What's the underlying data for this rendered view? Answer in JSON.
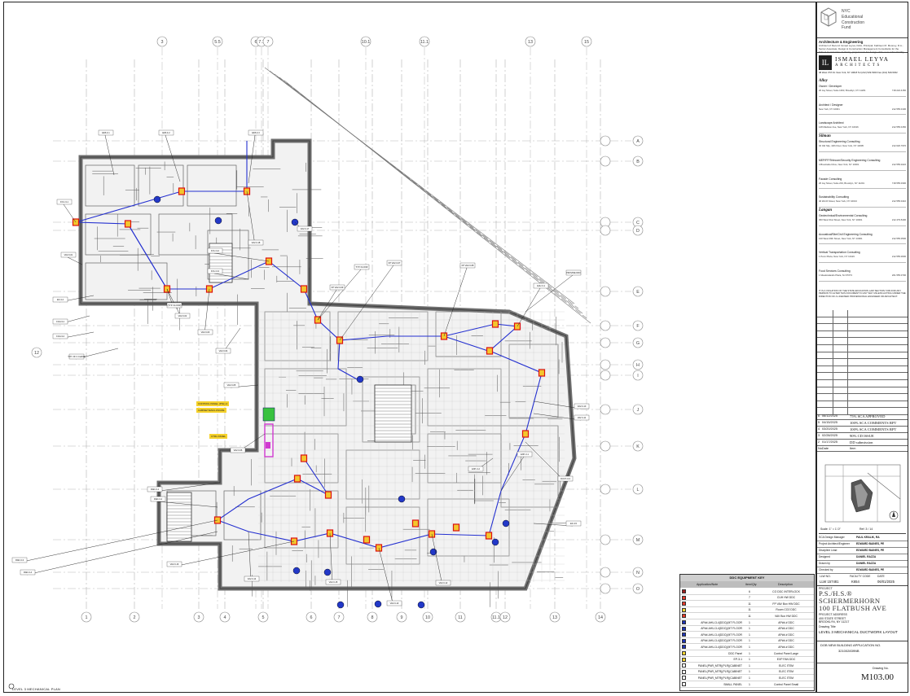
{
  "plan": {
    "title": "LEVEL 3 MECHANICAL PLAN",
    "grid_top": [
      "3",
      "5.5",
      "6",
      "7.1",
      "7",
      "10.1",
      "11.1",
      "13",
      "15"
    ],
    "grid_bottom": [
      "1",
      "2",
      "3",
      "4",
      "5",
      "6",
      "7",
      "8",
      "9",
      "10",
      "11",
      "11.1",
      "12",
      "13",
      "14"
    ],
    "grid_right": [
      "A",
      "B",
      "C",
      "D",
      "E",
      "F",
      "G",
      "H",
      "I",
      "J",
      "K",
      "L",
      "M",
      "N",
      "O"
    ],
    "grid_left": [
      "12"
    ]
  },
  "legend": {
    "title": "DDC EQUIPMENT KEY",
    "headers": {
      "application": "Application/Note",
      "qty": "Item/Qty",
      "description": "Description"
    },
    "rows": [
      {
        "application": "",
        "qty": "6",
        "description": "CO DDC INTERLOCK",
        "color": "#9b1e1e"
      },
      {
        "application": "",
        "qty": "7",
        "description": "CUH HW DDC",
        "color": "#e53a2a"
      },
      {
        "application": "",
        "qty": "11",
        "description": "FP VAV Box HW DDC",
        "color": "#e53a2a"
      },
      {
        "application": "",
        "qty": "11",
        "description": "Room CO2 DDC",
        "color": "#f3d32e"
      },
      {
        "application": "",
        "qty": "11",
        "description": "VAV Box HW DDC",
        "color": "#e53a2a"
      },
      {
        "application": "AP##-AHU-3-4(DDC)(MT FLOOR",
        "qty": "1",
        "description": "AP##-# DDC",
        "color": "#1f35b5"
      },
      {
        "application": "AP##-AHU-3-4(DDC)(MT FLOOR",
        "qty": "1",
        "description": "AP##-# DDC",
        "color": "#1f35b5"
      },
      {
        "application": "AP##-AHU-3-4(DDC)(MT FLOOR",
        "qty": "1",
        "description": "AP##-# DDC",
        "color": "#1f35b5"
      },
      {
        "application": "AP##-AHU-3-4(DDC)(MT FLOOR",
        "qty": "1",
        "description": "AP##-# DDC",
        "color": "#1f35b5"
      },
      {
        "application": "AP##-AHU-3-4(DDC)(MT FLOOR",
        "qty": "1",
        "description": "AP##-# DDC",
        "color": "#1f35b5"
      },
      {
        "application": "DDC Panel",
        "qty": "1",
        "description": "Control Panel Large",
        "color": "#f3d32e"
      },
      {
        "application": "EP-3-1",
        "qty": "1",
        "description": "EXP FAN DDC",
        "color": "#f3d32e"
      },
      {
        "application": "PANEL(PNR_MTR)(PLR)(CABINET",
        "qty": "1",
        "description": "ELEC ITEM",
        "color": "#ffffff"
      },
      {
        "application": "PANEL(PNR_MTR)(PLR)(CABINET",
        "qty": "1",
        "description": "ELEC ITEM",
        "color": "#ffffff"
      },
      {
        "application": "PANEL(PNR_MTR)(PLR)(CABINET",
        "qty": "1",
        "description": "ELEC ITEM",
        "color": "#ffffff"
      },
      {
        "application": "SMALL PANEL",
        "qty": "1",
        "description": "Control Panel Small",
        "color": "#ffffff"
      }
    ]
  },
  "titleblock": {
    "org": [
      "NYC",
      "Educational",
      "Construction",
      "Fund"
    ],
    "ae_heading": "Architecture & Engineering",
    "ae_text": "Architect of Record: Ismael Leyva, FAIA, Principal; Kathleen M. Mooney, R.A.; Senior Associate; Design & Construction Management Consultants for the School Construction Authority, project team for design of the new school facility.",
    "firm_name": "ISMAEL LEYVA",
    "firm_sub": "ARCHITECTS",
    "firm_mono": "IL",
    "firm_address": "48 West 37th St. New York, NY 10018  Tel (212) 529-5300  Fax (212) 529-5302",
    "consultants": [
      {
        "logo": "Alloy",
        "role": "Owner / Developer",
        "addr": "20 Jay Street, Suite 1003, Brooklyn, NY 11201",
        "phone": "718.222.4150"
      },
      {
        "logo": "",
        "role": "Architect / Designer",
        "addr": "New York, NY 10001",
        "phone": "212.555.0100"
      },
      {
        "logo": "",
        "role": "Landscape Architect",
        "addr": "148 Madison Ave, New York, NY 10016",
        "phone": "212.555.0150"
      },
      {
        "logo": "Silman",
        "role": "Structural Engineering Consulting",
        "addr": "32 Old Slip, 10th Floor, New York, NY 10005",
        "phone": "212.620.7970"
      },
      {
        "logo": "",
        "role": "MEP/FP/Telecom/Security Engineering Consulting",
        "addr": "4 Brookside Drive, New York, NY 10001",
        "phone": "212.555.0222"
      },
      {
        "logo": "",
        "role": "Facade Consulting",
        "addr": "26 Jay Street, Suite 204, Brooklyn, NY 11201",
        "phone": "718.555.0300"
      },
      {
        "logo": "",
        "role": "Sustainability Consulting",
        "addr": "40 Worth Street, New York, NY 10013",
        "phone": "212.555.0410"
      },
      {
        "logo": "Langan",
        "role": "Geotechnical/Environmental Consulting",
        "addr": "360 West 31st Street, New York, NY 10001",
        "phone": "212.479.5400"
      },
      {
        "logo": "",
        "role": "Acoustical/Site/Civil Engineering Consulting",
        "addr": "130 West 29th Street, New York, NY 10001",
        "phone": "212.555.0500"
      },
      {
        "logo": "",
        "role": "Vertical Transportation Consulting",
        "addr": "1 Penn Plaza, New York, NY 10119",
        "phone": "212.555.0600"
      },
      {
        "logo": "",
        "role": "Food Services Consulting",
        "addr": "1 Meadowlands Plaza, NJ 07073",
        "phone": "201.555.0700"
      }
    ],
    "note": "IT IS A VIOLATION OF THE STATE EDUCATION LAW SECTION 7209 FOR ANY PERSON TO ALTER THIS DOCUMENT IN ANY WAY UNLESS ACTING UNDER THE DIRECTION OF A LICENSED PROFESSIONAL ENGINEER OR ARCHITECT.",
    "revisions": [
      {
        "no": "6",
        "date": "06/12/2025",
        "text": "75% SCA APPROVED"
      },
      {
        "no": "5",
        "date": "04/15/2025",
        "text": "100% SCA COMMENTS RPT"
      },
      {
        "no": "4",
        "date": "03/20/2025",
        "text": "100% SCA COMMENTS RPT"
      },
      {
        "no": "3",
        "date": "02/28/2025",
        "text": "90% CD ISSUE"
      },
      {
        "no": "2",
        "date": "01/17/2025",
        "text": "DD submission"
      }
    ],
    "rev_head": {
      "no": "No.",
      "date": "Date",
      "item": "Item"
    },
    "key_plan": {
      "label": "Key Plan",
      "scale": "Scale: 1\" = 1'-0\"",
      "sheet": "Ref: 3 / 14"
    },
    "info": [
      {
        "k": "SCA Design Manager",
        "v": "PAUL KRALIK, RA"
      },
      {
        "k": "Project Architect/Engineer",
        "v": "EDWARD BAINES, PE"
      },
      {
        "k": "Discipline Lead",
        "v": "EDWARD BAINES, PE"
      },
      {
        "k": "Designed",
        "v": "DANIEL RAZZA"
      },
      {
        "k": "Drawn by",
        "v": "DANIEL RAZZA"
      },
      {
        "k": "Checked by",
        "v": "EDWARD BAINES, PE"
      }
    ],
    "license": {
      "k1": "LLW NO.",
      "v1": "LLW 157481",
      "k2": "FACILITY CODE",
      "v2": "K654",
      "k3": "DATE",
      "v3": "06/01/2025"
    },
    "project_label": "PROJECT",
    "project_name": "P.S./H.S.® SCHERMERHORN",
    "project_name2": "100 FLATBUSH AVE",
    "project_addr_label": "PROJECT ADDRESS",
    "project_addr1": "400 STATE STREET",
    "project_addr2": "BROOKLYN, NY 11217",
    "drawing_title_label": "Drawing Title",
    "drawing_title": "LEVEL 3 MECHANICAL DUCTWORK LAYOUT",
    "dob_label": "DOB NEW BUILDING APPLICATION NO.",
    "dob_no": "321002839NB",
    "drawing_no_label": "Drawing No.",
    "drawing_no": "M103.00"
  },
  "callouts": {
    "control_panel": "CONTROL PANEL (PNL) A",
    "control_panel2": "CABINET/ENCLOSURE",
    "control_small": "CTRL PANEL",
    "tag_typ": "(TYP. FLOOR)"
  }
}
